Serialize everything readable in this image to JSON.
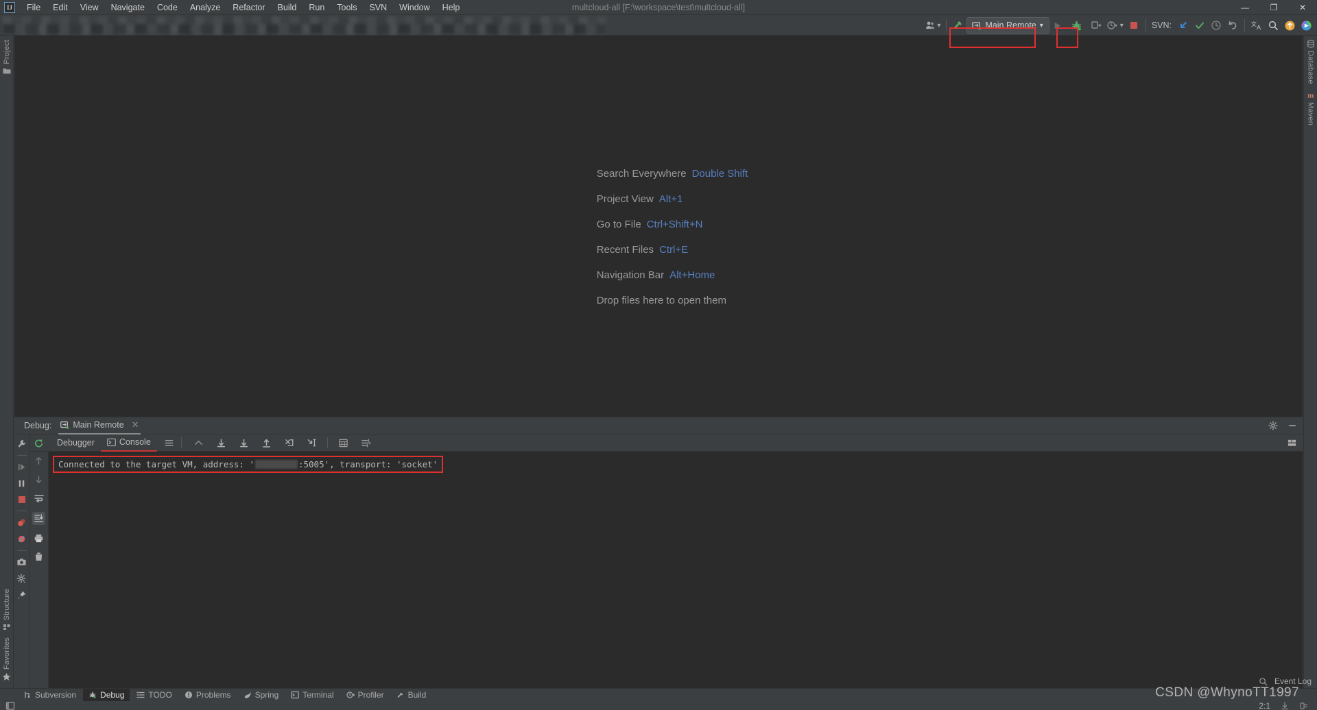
{
  "window": {
    "title": "multcloud-all [F:\\workspace\\test\\multcloud-all]",
    "minimize_label": "—",
    "maximize_label": "❐",
    "close_label": "✕",
    "logo_label": "IJ"
  },
  "menubar": {
    "items": [
      {
        "label": "File"
      },
      {
        "label": "Edit"
      },
      {
        "label": "View"
      },
      {
        "label": "Navigate"
      },
      {
        "label": "Code"
      },
      {
        "label": "Analyze"
      },
      {
        "label": "Refactor"
      },
      {
        "label": "Build"
      },
      {
        "label": "Run"
      },
      {
        "label": "Tools"
      },
      {
        "label": "SVN"
      },
      {
        "label": "Window"
      },
      {
        "label": "Help"
      }
    ]
  },
  "toolbar": {
    "run_config_label": "Main Remote",
    "run_config_caret": "▾",
    "svn_label": "SVN:",
    "icons": {
      "users": "users-icon",
      "caret": "▾",
      "build": "hammer-icon",
      "run": "run-icon",
      "debug": "debug-icon",
      "coverage": "run-with-coverage-icon",
      "profile": "profile-icon",
      "stop": "stop-icon",
      "svn_update": "svn-update-icon",
      "svn_commit": "svn-commit-icon",
      "svn_history": "svn-history-icon",
      "svn_revert": "svn-revert-icon",
      "translate": "translate-icon",
      "search": "search-icon",
      "update_available": "update-icon",
      "plugin": "plugin-icon"
    }
  },
  "left_stripe": {
    "top": [
      {
        "label": "Project",
        "icon": "folder-icon"
      }
    ],
    "bottom": [
      {
        "label": "Structure",
        "icon": "structure-icon"
      },
      {
        "label": "Favorites",
        "icon": "star-icon"
      }
    ]
  },
  "right_stripe": {
    "items": [
      {
        "label": "Database",
        "icon": "database-icon"
      },
      {
        "label": "Maven",
        "icon": "maven-icon"
      }
    ]
  },
  "editor": {
    "hints": [
      {
        "action": "Search Everywhere",
        "shortcut": "Double Shift"
      },
      {
        "action": "Project View",
        "shortcut": "Alt+1"
      },
      {
        "action": "Go to File",
        "shortcut": "Ctrl+Shift+N"
      },
      {
        "action": "Recent Files",
        "shortcut": "Ctrl+E"
      },
      {
        "action": "Navigation Bar",
        "shortcut": "Alt+Home"
      },
      {
        "action": "Drop files here to open them",
        "shortcut": ""
      }
    ]
  },
  "debug_window": {
    "title": "Debug:",
    "session_tab": "Main Remote",
    "session_close": "✕",
    "subtabs": [
      {
        "label": "Debugger",
        "icon": "debugger-icon",
        "active": false
      },
      {
        "label": "Console",
        "icon": "console-icon",
        "active": true
      }
    ],
    "header_icons": {
      "settings": "gear-icon",
      "hide": "minimize-icon",
      "layout": "layout-settings-icon"
    },
    "left_rail_icons": [
      "wrench-icon",
      "resume-program-icon",
      "pause-program-icon",
      "stop-icon",
      "view-breakpoints-icon",
      "mute-breakpoints-icon",
      "screenshot-icon",
      "settings-icon",
      "pin-tab-icon"
    ],
    "stepping_icons": [
      "show-execution-point-icon",
      "step-over-icon",
      "step-into-icon",
      "force-step-into-icon",
      "step-out-icon",
      "drop-frame-icon",
      "run-to-cursor-icon",
      "evaluate-expression-icon",
      "watches-icon"
    ],
    "console_rail_icons": [
      "up-arrow-icon",
      "down-arrow-icon",
      "soft-wrap-icon",
      "scroll-to-end-icon",
      "print-icon",
      "clear-all-icon"
    ],
    "console": {
      "prefix": "Connected to the target VM, address: '",
      "redacted": "",
      "suffix": ":5005', transport: 'socket'"
    }
  },
  "statusbar": {
    "tools": [
      {
        "label": "Subversion",
        "icon": "subversion-icon",
        "active": false
      },
      {
        "label": "Debug",
        "icon": "debug-icon",
        "active": true
      },
      {
        "label": "TODO",
        "icon": "todo-icon",
        "active": false
      },
      {
        "label": "Problems",
        "icon": "problems-icon",
        "active": false
      },
      {
        "label": "Spring",
        "icon": "spring-icon",
        "active": false
      },
      {
        "label": "Terminal",
        "icon": "terminal-icon",
        "active": false
      },
      {
        "label": "Profiler",
        "icon": "profiler-icon",
        "active": false
      },
      {
        "label": "Build",
        "icon": "build-icon",
        "active": false
      }
    ],
    "event_log": "Event Log",
    "caret_position": "2:1",
    "watermark": "CSDN @WhynoTT1997"
  },
  "colors": {
    "accent_red": "#e03030",
    "link_blue": "#5680c2",
    "bg_panel": "#3c3f41",
    "bg_editor": "#2b2b2b",
    "green": "#59a869",
    "stop_red": "#c75450"
  }
}
